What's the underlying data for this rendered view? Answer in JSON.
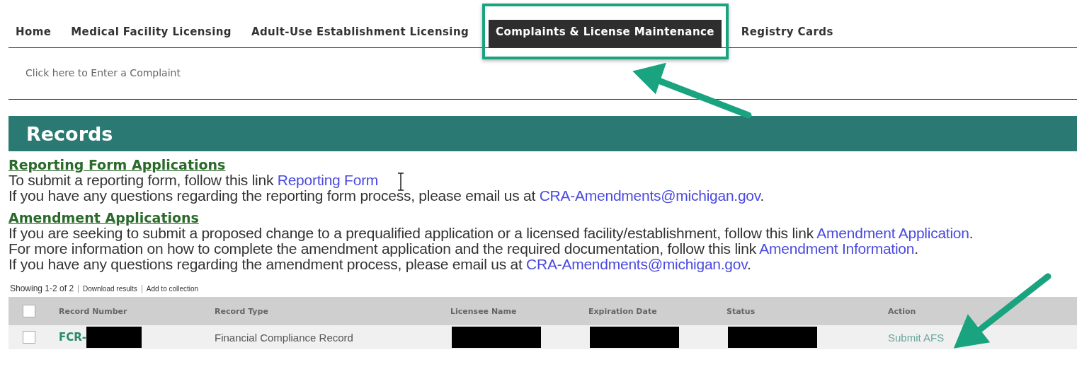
{
  "nav": {
    "tabs": [
      {
        "label": "Home",
        "selected": false
      },
      {
        "label": "Medical Facility Licensing",
        "selected": false
      },
      {
        "label": "Adult-Use Establishment Licensing",
        "selected": false
      },
      {
        "label": "Complaints & License Maintenance",
        "selected": true
      },
      {
        "label": "Registry Cards",
        "selected": false
      }
    ]
  },
  "subnav": {
    "link": "Click here to Enter a Complaint"
  },
  "banner": {
    "title": "Records"
  },
  "sections": [
    {
      "heading": "Reporting Form Applications",
      "lines": [
        [
          {
            "text": "To submit a reporting form, follow this link ",
            "link": false
          },
          {
            "text": "Reporting Form",
            "link": true
          }
        ],
        [
          {
            "text": "If you have any questions regarding the reporting form process, please email us at ",
            "link": false
          },
          {
            "text": "CRA-Amendments@michigan.gov",
            "link": true
          },
          {
            "text": ".",
            "link": false
          }
        ]
      ]
    },
    {
      "heading": "Amendment Applications",
      "lines": [
        [
          {
            "text": "If you are seeking to submit a proposed change to a prequalified application or a licensed facility/establishment, follow this link ",
            "link": false
          },
          {
            "text": "Amendment Application",
            "link": true
          },
          {
            "text": ".",
            "link": false
          }
        ],
        [
          {
            "text": "For more information on how to complete the amendment application and the required documentation, follow this link ",
            "link": false
          },
          {
            "text": "Amendment Information",
            "link": true
          },
          {
            "text": ".",
            "link": false
          }
        ],
        [
          {
            "text": "If you have any questions regarding the amendment process, please email us at ",
            "link": false
          },
          {
            "text": "CRA-Amendments@michigan.gov",
            "link": true
          },
          {
            "text": ".",
            "link": false
          }
        ]
      ]
    }
  ],
  "results": {
    "summary": "Showing 1-2 of 2",
    "actions": [
      "Download results",
      "Add to collection"
    ]
  },
  "table": {
    "header_checked": false,
    "columns": [
      "Record Number",
      "Record Type",
      "Licensee Name",
      "Expiration Date",
      "Status",
      "Action"
    ],
    "rows": [
      {
        "checked": false,
        "cells": [
          {
            "text": "FCR-",
            "redacted": true,
            "kind": "link"
          },
          {
            "text": "Financial Compliance Record",
            "redacted": false,
            "kind": "text"
          },
          {
            "kind": "redacted"
          },
          {
            "kind": "redacted"
          },
          {
            "kind": "redacted"
          },
          {
            "text": "Submit AFS",
            "redacted": false,
            "kind": "action"
          }
        ]
      }
    ]
  }
}
